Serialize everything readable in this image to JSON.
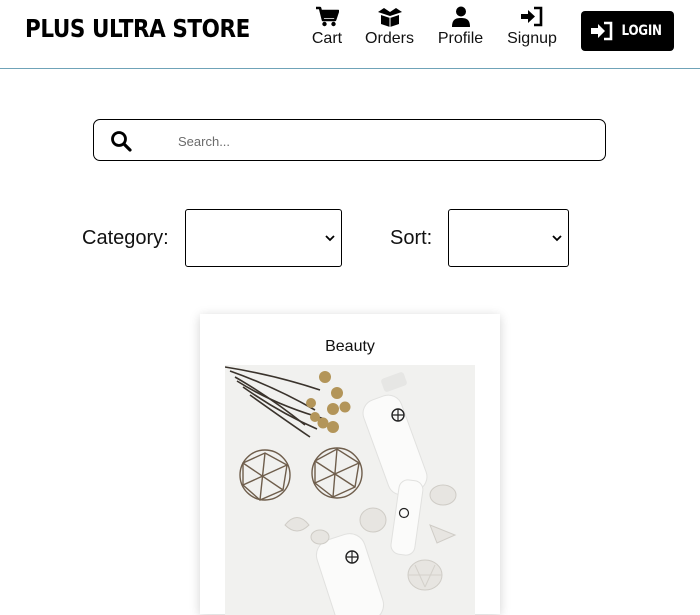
{
  "header": {
    "brand": "PLUS ULTRA STORE",
    "nav": {
      "cart": "Cart",
      "orders": "Orders",
      "profile": "Profile",
      "signup": "Signup"
    },
    "login_label": "LOGIN"
  },
  "search": {
    "placeholder": "Search...",
    "value": ""
  },
  "filters": {
    "category_label": "Category:",
    "category_value": "",
    "sort_label": "Sort:",
    "sort_value": ""
  },
  "product": {
    "title": "Beauty"
  },
  "colors": {
    "header_border": "#6fa3b8",
    "login_bg": "#000000",
    "text": "#111111"
  }
}
